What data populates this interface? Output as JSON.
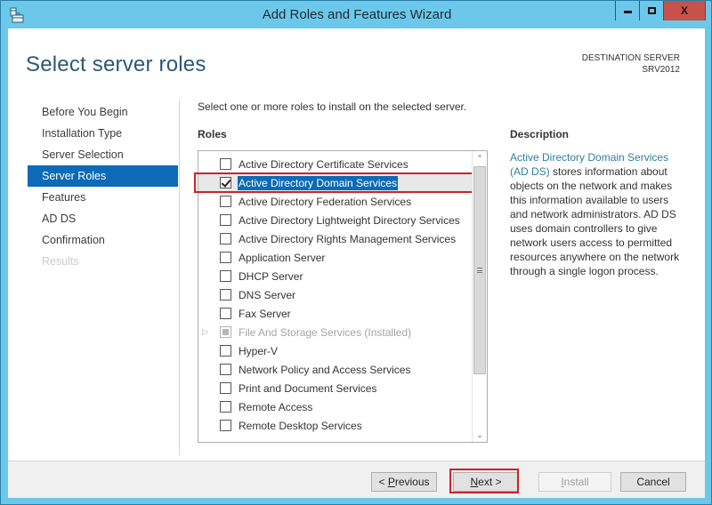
{
  "window": {
    "title": "Add Roles and Features Wizard",
    "controls": {
      "minimize": "minimize",
      "maximize": "maximize",
      "close": "X"
    }
  },
  "header": {
    "page_title": "Select server roles",
    "destination_label": "DESTINATION SERVER",
    "destination_value": "SRV2012"
  },
  "nav": {
    "items": [
      {
        "label": "Before You Begin",
        "state": "normal"
      },
      {
        "label": "Installation Type",
        "state": "normal"
      },
      {
        "label": "Server Selection",
        "state": "normal"
      },
      {
        "label": "Server Roles",
        "state": "active"
      },
      {
        "label": "Features",
        "state": "normal"
      },
      {
        "label": "AD DS",
        "state": "normal"
      },
      {
        "label": "Confirmation",
        "state": "normal"
      },
      {
        "label": "Results",
        "state": "disabled"
      }
    ]
  },
  "main": {
    "instruction": "Select one or more roles to install on the selected server.",
    "roles_heading": "Roles",
    "roles": [
      {
        "label": "Active Directory Certificate Services",
        "checked": false
      },
      {
        "label": "Active Directory Domain Services",
        "checked": true,
        "selected": true
      },
      {
        "label": "Active Directory Federation Services",
        "checked": false
      },
      {
        "label": "Active Directory Lightweight Directory Services",
        "checked": false
      },
      {
        "label": "Active Directory Rights Management Services",
        "checked": false
      },
      {
        "label": "Application Server",
        "checked": false
      },
      {
        "label": "DHCP Server",
        "checked": false
      },
      {
        "label": "DNS Server",
        "checked": false
      },
      {
        "label": "Fax Server",
        "checked": false
      },
      {
        "label": "File And Storage Services (Installed)",
        "checked": "partial",
        "installed": true,
        "expandable": true
      },
      {
        "label": "Hyper-V",
        "checked": false
      },
      {
        "label": "Network Policy and Access Services",
        "checked": false
      },
      {
        "label": "Print and Document Services",
        "checked": false
      },
      {
        "label": "Remote Access",
        "checked": false
      },
      {
        "label": "Remote Desktop Services",
        "checked": false
      }
    ],
    "scroll_position": 0
  },
  "description": {
    "heading": "Description",
    "link_text": "Active Directory Domain Services (AD DS)",
    "body": " stores information about objects on the network and makes this information available to users and network administrators. AD DS uses domain controllers to give network users access to permitted resources anywhere on the network through a single logon process."
  },
  "footer": {
    "previous": {
      "prefix": "< ",
      "accel": "P",
      "rest": "revious"
    },
    "next": {
      "accel": "N",
      "rest": "ext >"
    },
    "install": {
      "accel": "I",
      "rest": "nstall",
      "enabled": false
    },
    "cancel": "Cancel"
  },
  "colors": {
    "accent": "#0c6ab6",
    "highlight_annotation": "#d0202a",
    "frame": "#6cc8ea",
    "close_button": "#c7524a"
  }
}
